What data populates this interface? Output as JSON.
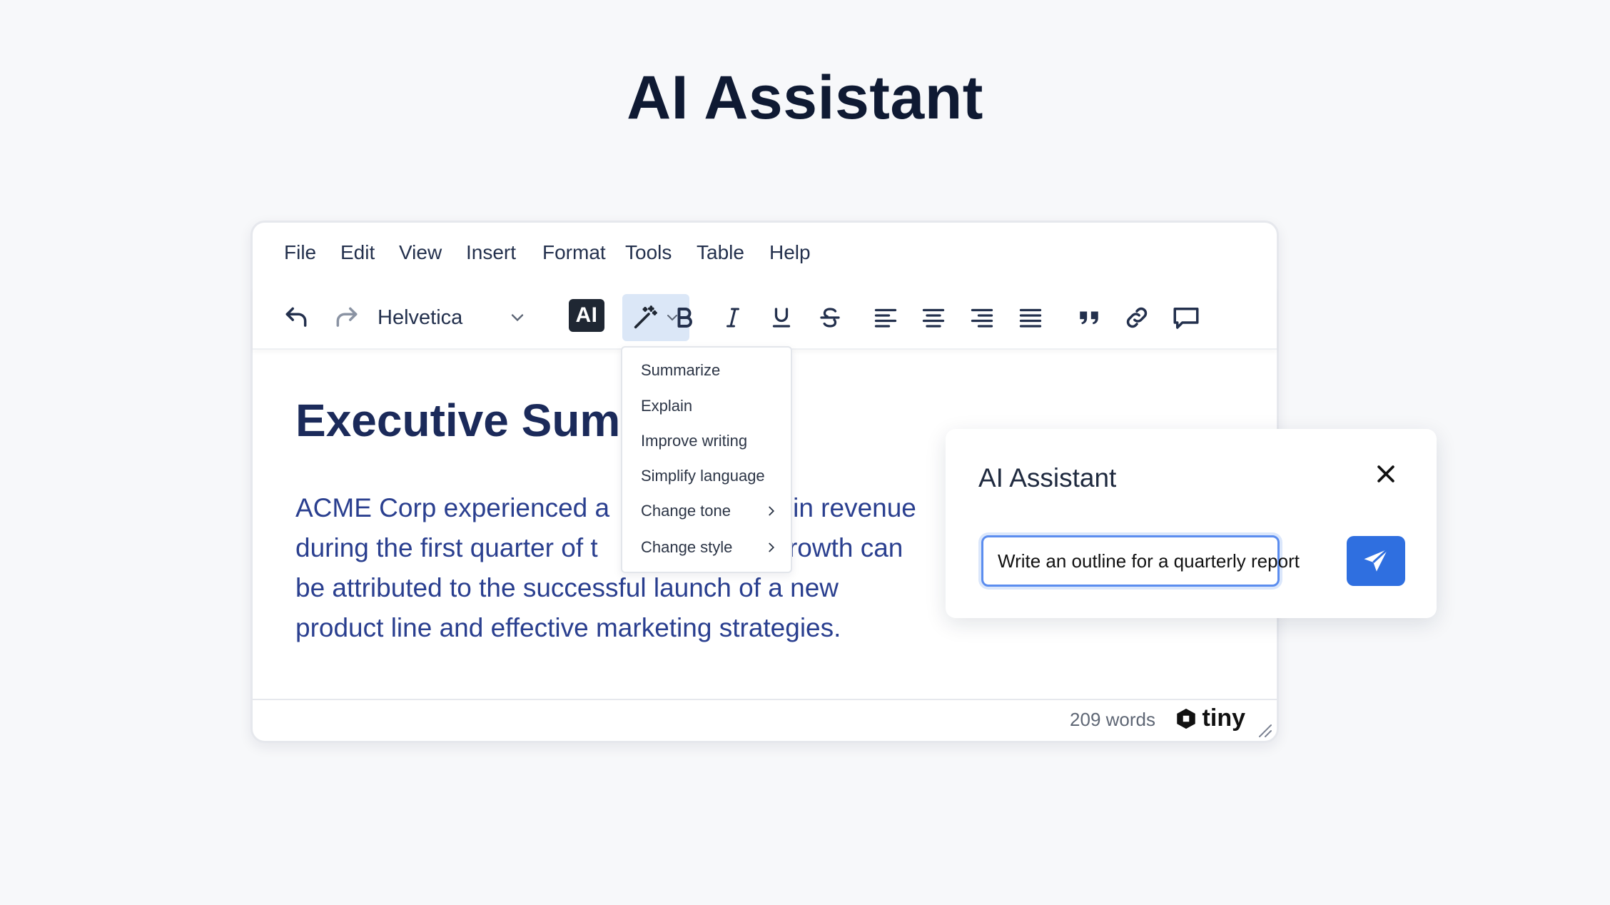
{
  "page": {
    "title": "AI Assistant"
  },
  "menubar": {
    "items": [
      "File",
      "Edit",
      "View",
      "Insert",
      "Format",
      "Tools",
      "Table",
      "Help"
    ]
  },
  "toolbar": {
    "font": "Helvetica",
    "ai_label": "AI",
    "icons": [
      "undo-icon",
      "redo-icon",
      "chevron-down-icon",
      "ai-icon",
      "magic-wand-icon",
      "bold-icon",
      "italic-icon",
      "underline-icon",
      "strikethrough-icon",
      "align-left-icon",
      "align-center-icon",
      "align-right-icon",
      "align-justify-icon",
      "quote-icon",
      "link-icon",
      "comment-icon"
    ]
  },
  "dropdown": {
    "items": [
      {
        "label": "Summarize",
        "submenu": false
      },
      {
        "label": "Explain",
        "submenu": false
      },
      {
        "label": "Improve writing",
        "submenu": false
      },
      {
        "label": "Simplify language",
        "submenu": false
      },
      {
        "label": "Change tone",
        "submenu": true
      },
      {
        "label": "Change style",
        "submenu": true
      }
    ]
  },
  "document": {
    "heading": "Executive Sum",
    "para_lines": [
      "ACME Corp experienced a                         in revenue",
      "during the first quarter of t                        growth can",
      "be attributed to the successful launch of a new",
      "product line and effective marketing strategies."
    ]
  },
  "statusbar": {
    "word_count": "209 words",
    "brand": "tiny"
  },
  "ai_panel": {
    "title": "AI Assistant",
    "input_value": "Write an outline for a quarterly report",
    "send_icon": "send-icon",
    "close_icon": "close-icon"
  },
  "colors": {
    "accent": "#2f6fe0",
    "heading": "#1b2a5a",
    "body_text": "#2a3f8f",
    "wand_active_bg": "#dbe7f7"
  }
}
